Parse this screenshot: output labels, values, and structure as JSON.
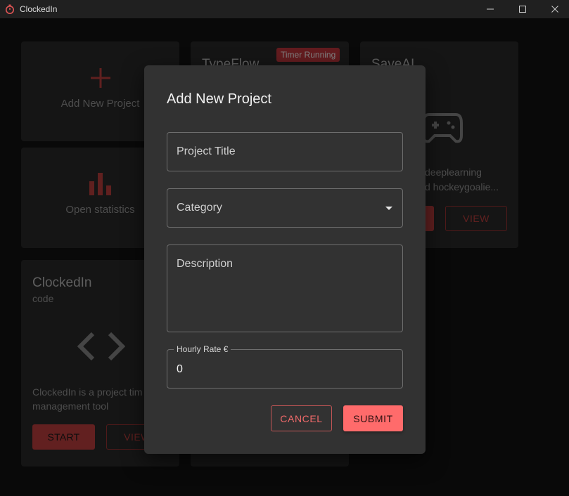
{
  "window": {
    "title": "ClockedIn",
    "controls": [
      "minimize-icon",
      "maximize-icon",
      "close-icon"
    ]
  },
  "background": {
    "add_project_card": {
      "label": "Add New Project",
      "icon": "plus-icon"
    },
    "statistics_card": {
      "label": "Open statistics",
      "icon": "bar-chart-icon"
    },
    "typeflow_card": {
      "title": "TypeFlow",
      "badge": "Timer Running"
    },
    "saveai_card": {
      "title": "SaveAI",
      "icon": "gamepad-icon",
      "description_line1": "deeplearning",
      "description_line2": "d hockeygoalie...",
      "view_label": "VIEW"
    },
    "clockedin_card": {
      "title": "ClockedIn",
      "category": "code",
      "icon": "code-brackets-icon",
      "description_line1": "ClockedIn is a project tim",
      "description_line2": "management tool",
      "start_label": "START",
      "view_label": "VIEW"
    }
  },
  "dialog": {
    "title": "Add New Project",
    "project_title_placeholder": "Project Title",
    "category_placeholder": "Category",
    "description_placeholder": "Description",
    "hourly_rate_label": "Hourly Rate €",
    "hourly_rate_value": "0",
    "cancel_label": "CANCEL",
    "submit_label": "SUBMIT"
  },
  "colors": {
    "accent": "#ff6b6b",
    "accent_dim": "#c0403f",
    "dialog_bg": "#323232",
    "app_bg": "#121212"
  }
}
